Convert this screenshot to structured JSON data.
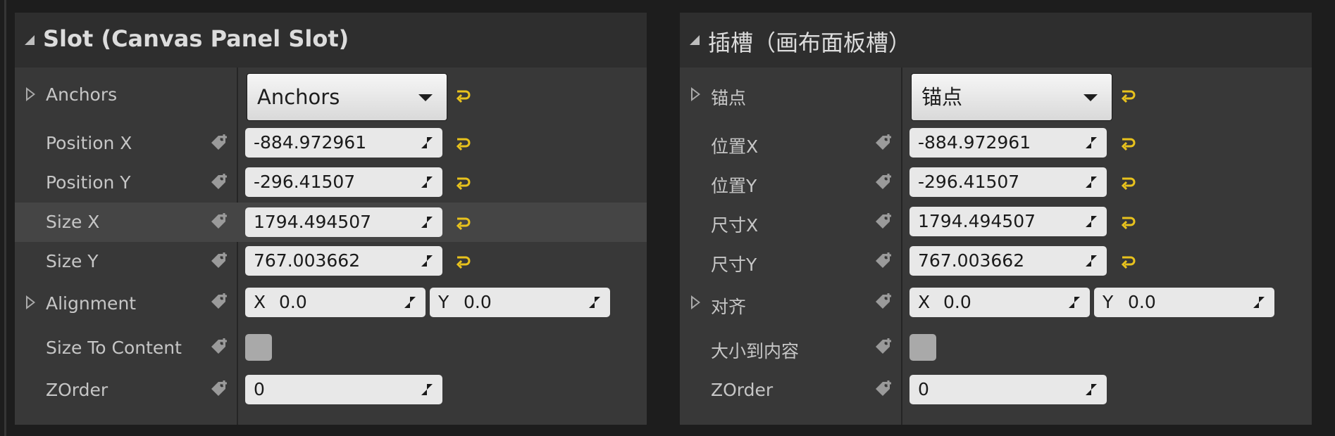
{
  "colors": {
    "accent_reset": "#e8c21d",
    "panel_bg": "#383838",
    "header_bg": "#2e2e2e",
    "field_bg": "#e8e8e8"
  },
  "panels": [
    {
      "title": "Slot (Canvas Panel Slot)",
      "anchors_label": "Anchors",
      "anchors_value": "Anchors",
      "position_x_label": "Position X",
      "position_x_value": "-884.972961",
      "position_y_label": "Position Y",
      "position_y_value": "-296.41507",
      "size_x_label": "Size X",
      "size_x_value": "1794.494507",
      "size_y_label": "Size Y",
      "size_y_value": "767.003662",
      "alignment_label": "Alignment",
      "alignment_x_axis": "X",
      "alignment_x_value": "0.0",
      "alignment_y_axis": "Y",
      "alignment_y_value": "0.0",
      "size_to_content_label": "Size To Content",
      "zorder_label": "ZOrder",
      "zorder_value": "0"
    },
    {
      "title": "插槽（画布面板槽）",
      "anchors_label": "锚点",
      "anchors_value": "锚点",
      "position_x_label": "位置X",
      "position_x_value": "-884.972961",
      "position_y_label": "位置Y",
      "position_y_value": "-296.41507",
      "size_x_label": "尺寸X",
      "size_x_value": "1794.494507",
      "size_y_label": "尺寸Y",
      "size_y_value": "767.003662",
      "alignment_label": "对齐",
      "alignment_x_axis": "X",
      "alignment_x_value": "0.0",
      "alignment_y_axis": "Y",
      "alignment_y_value": "0.0",
      "size_to_content_label": "大小到内容",
      "zorder_label": "ZOrder",
      "zorder_value": "0"
    }
  ],
  "icons": {
    "collapse": "collapse-triangle-icon",
    "expand": "expand-arrow-icon",
    "bind": "property-binding-icon",
    "reset": "reset-to-default-icon",
    "spin": "drag-spin-icon"
  }
}
